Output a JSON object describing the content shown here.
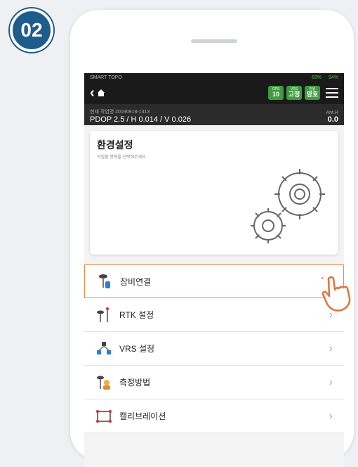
{
  "step": "02",
  "status_bar": {
    "app": "SMART TOPO",
    "battery_gnss": "69%",
    "battery_device": "94%"
  },
  "badges": [
    {
      "top": "GPS",
      "value": "10"
    },
    {
      "top": "VRS",
      "value": "고정"
    },
    {
      "top": "전원",
      "value": "양호"
    }
  ],
  "info": {
    "job": "현재 작업명 20190918-1313",
    "pdop": "PDOP 2.5 / H 0.014 / V 0.026",
    "ant_label": "Ant.H",
    "ant_value": "0.0"
  },
  "hero": {
    "title": "환경설정",
    "subtitle": "작업할 항목을 선택해주세요."
  },
  "menu": [
    {
      "label": "장비연결",
      "icon": "receiver-connect-icon"
    },
    {
      "label": "RTK 설정",
      "icon": "rtk-antenna-icon"
    },
    {
      "label": "VRS 설정",
      "icon": "vrs-network-icon"
    },
    {
      "label": "측정방법",
      "icon": "survey-worker-icon"
    },
    {
      "label": "캘리브레이션",
      "icon": "calibration-frame-icon"
    }
  ],
  "colors": {
    "badge_green": "#3f9b3f",
    "highlight": "#ef8a4f",
    "step_blue": "#1e5c8c"
  }
}
